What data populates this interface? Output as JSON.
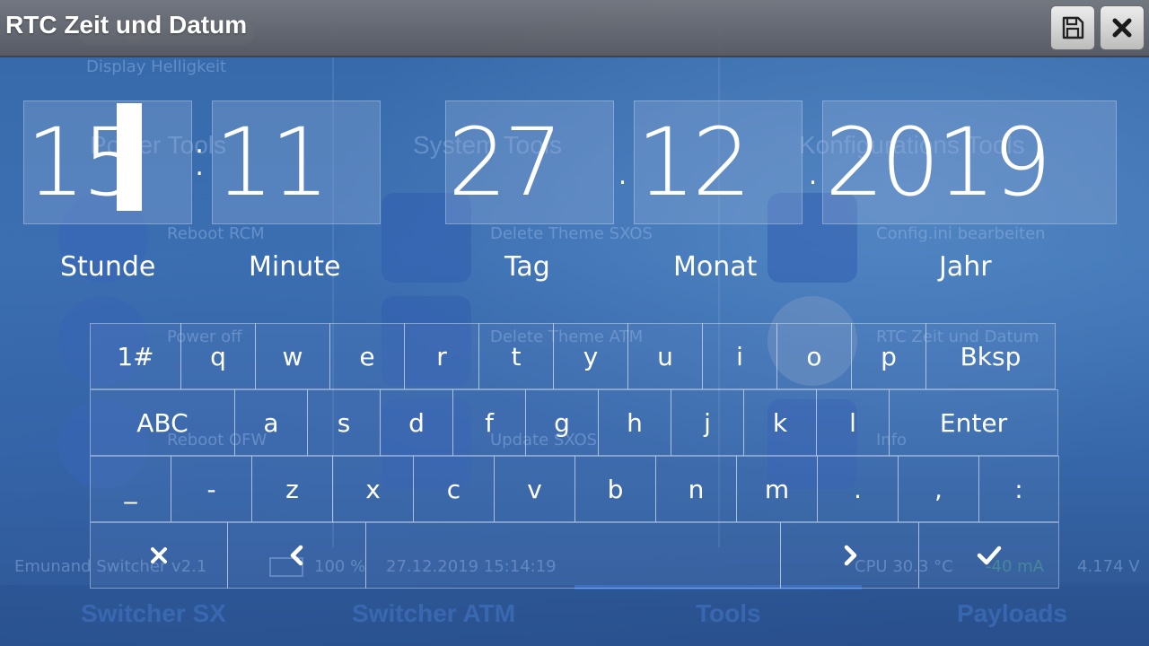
{
  "window": {
    "title": "RTC Zeit und Datum",
    "save_icon": "save-icon",
    "close_icon": "close-icon"
  },
  "fields": {
    "hour": "15",
    "minute": "11",
    "day": "27",
    "month": "12",
    "year": "2019",
    "time_separator": ":",
    "date_separator_1": ".",
    "date_separator_2": ".",
    "labels": {
      "hour": "Stunde",
      "minute": "Minute",
      "day": "Tag",
      "month": "Monat",
      "year": "Jahr"
    }
  },
  "keyboard": {
    "row1": [
      "1#",
      "q",
      "w",
      "e",
      "r",
      "t",
      "y",
      "u",
      "i",
      "o",
      "p",
      "Bksp"
    ],
    "row2": [
      "ABC",
      "a",
      "s",
      "d",
      "f",
      "g",
      "h",
      "j",
      "k",
      "l",
      "Enter"
    ],
    "row3": [
      "_",
      "-",
      "z",
      "x",
      "c",
      "v",
      "b",
      "n",
      "m",
      ".",
      ",",
      ":"
    ],
    "row4_icons": [
      "cancel-icon",
      "arrow-left-icon",
      "space",
      "arrow-right-icon",
      "confirm-icon"
    ]
  },
  "background": {
    "brightness_label": "Display Helligkeit",
    "columns": [
      "Power Tools",
      "System Tools",
      "Konfigurations Tools"
    ],
    "items": [
      "Reboot RCM",
      "Power off",
      "Reboot OFW",
      "Delete Theme SXOS",
      "Delete Theme ATM",
      "Update SXOS",
      "Config.ini bearbeiten",
      "RTC Zeit und Datum",
      "Info"
    ],
    "status": {
      "app": "Emunand Switcher v2.1",
      "battery": "100 %",
      "datetime": "27.12.2019  15:14:19",
      "cpu": "CPU 30.3 °C",
      "current": "-40 mA",
      "voltage": "4.174 V"
    },
    "nav": [
      "Switcher SX",
      "Switcher ATM",
      "Tools",
      "Payloads"
    ]
  }
}
